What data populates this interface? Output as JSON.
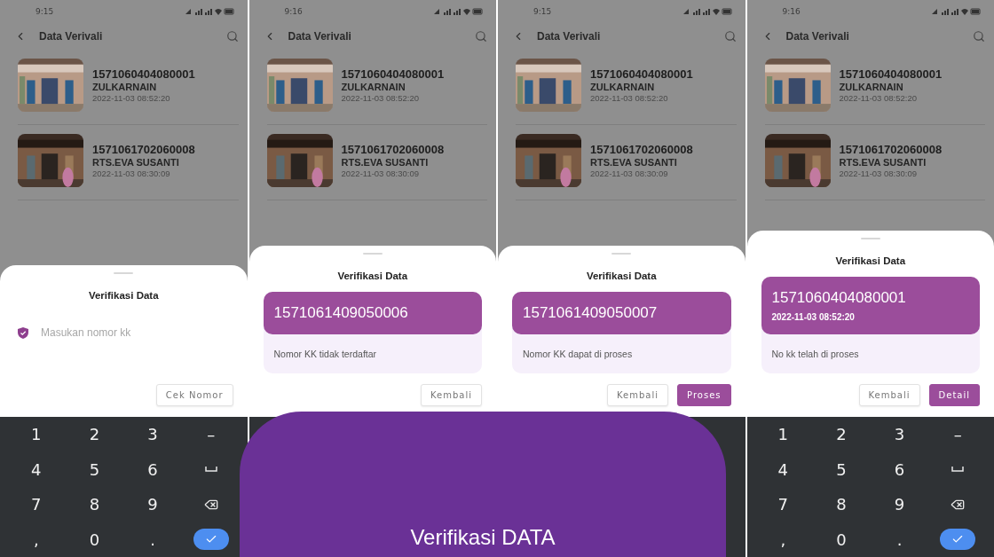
{
  "panels": [
    {
      "status_time": "9:15",
      "app_title": "Data Verivali",
      "records": [
        {
          "kk": "1571060404080001",
          "name": "ZULKARNAIN",
          "date": "2022-11-03 08:52:20"
        },
        {
          "kk": "1571061702060008",
          "name": "RTS.EVA SUSANTI",
          "date": "2022-11-03 08:30:09"
        }
      ],
      "sheet": {
        "title": "Verifikasi Data",
        "kind": "input",
        "placeholder": "Masukan nomor kk",
        "buttons": [
          {
            "label": "Cek Nomor",
            "primary": false
          }
        ]
      },
      "keyboard": [
        {
          "kind": "text",
          "label": "1"
        },
        {
          "kind": "text",
          "label": "2"
        },
        {
          "kind": "text",
          "label": "3"
        },
        {
          "kind": "text",
          "label": "–"
        },
        {
          "kind": "text",
          "label": "4"
        },
        {
          "kind": "text",
          "label": "5"
        },
        {
          "kind": "text",
          "label": "6"
        },
        {
          "kind": "space"
        },
        {
          "kind": "text",
          "label": "7"
        },
        {
          "kind": "text",
          "label": "8"
        },
        {
          "kind": "text",
          "label": "9"
        },
        {
          "kind": "backspace"
        },
        {
          "kind": "text",
          "label": ","
        },
        {
          "kind": "text",
          "label": "0"
        },
        {
          "kind": "text",
          "label": "."
        },
        {
          "kind": "enter"
        }
      ]
    },
    {
      "status_time": "9:16",
      "app_title": "Data Verivali",
      "records": [
        {
          "kk": "1571060404080001",
          "name": "ZULKARNAIN",
          "date": "2022-11-03 08:52:20"
        },
        {
          "kk": "1571061702060008",
          "name": "RTS.EVA SUSANTI",
          "date": "2022-11-03 08:30:09"
        }
      ],
      "sheet": {
        "title": "Verifikasi Data",
        "kind": "result",
        "number": "1571061409050006",
        "message": "Nomor KK tidak terdaftar",
        "buttons": [
          {
            "label": "Kembali",
            "primary": false
          }
        ]
      }
    },
    {
      "status_time": "9:15",
      "app_title": "Data Verivali",
      "records": [
        {
          "kk": "1571060404080001",
          "name": "ZULKARNAIN",
          "date": "2022-11-03 08:52:20"
        },
        {
          "kk": "1571061702060008",
          "name": "RTS.EVA SUSANTI",
          "date": "2022-11-03 08:30:09"
        }
      ],
      "sheet": {
        "title": "Verifikasi Data",
        "kind": "result",
        "number": "1571061409050007",
        "message": "Nomor KK dapat di proses",
        "buttons": [
          {
            "label": "Kembali",
            "primary": false
          },
          {
            "label": "Proses",
            "primary": true
          }
        ]
      }
    },
    {
      "status_time": "9:16",
      "app_title": "Data Verivali",
      "records": [
        {
          "kk": "1571060404080001",
          "name": "ZULKARNAIN",
          "date": "2022-11-03 08:52:20"
        },
        {
          "kk": "1571061702060008",
          "name": "RTS.EVA SUSANTI",
          "date": "2022-11-03 08:30:09"
        }
      ],
      "sheet": {
        "title": "Verifikasi Data",
        "kind": "result",
        "number": "1571060404080001",
        "date": "2022-11-03 08:52:20",
        "message": "No kk telah di proses",
        "buttons": [
          {
            "label": "Kembali",
            "primary": false
          },
          {
            "label": "Detail",
            "primary": true
          }
        ]
      },
      "keyboard": [
        {
          "kind": "text",
          "label": "1"
        },
        {
          "kind": "text",
          "label": "2"
        },
        {
          "kind": "text",
          "label": "3"
        },
        {
          "kind": "text",
          "label": "–"
        },
        {
          "kind": "text",
          "label": "4"
        },
        {
          "kind": "text",
          "label": "5"
        },
        {
          "kind": "text",
          "label": "6"
        },
        {
          "kind": "space"
        },
        {
          "kind": "text",
          "label": "7"
        },
        {
          "kind": "text",
          "label": "8"
        },
        {
          "kind": "text",
          "label": "9"
        },
        {
          "kind": "backspace"
        },
        {
          "kind": "text",
          "label": ","
        },
        {
          "kind": "text",
          "label": "0"
        },
        {
          "kind": "text",
          "label": "."
        },
        {
          "kind": "enter"
        }
      ]
    }
  ],
  "banner": {
    "text": "Verifikasi DATA"
  }
}
